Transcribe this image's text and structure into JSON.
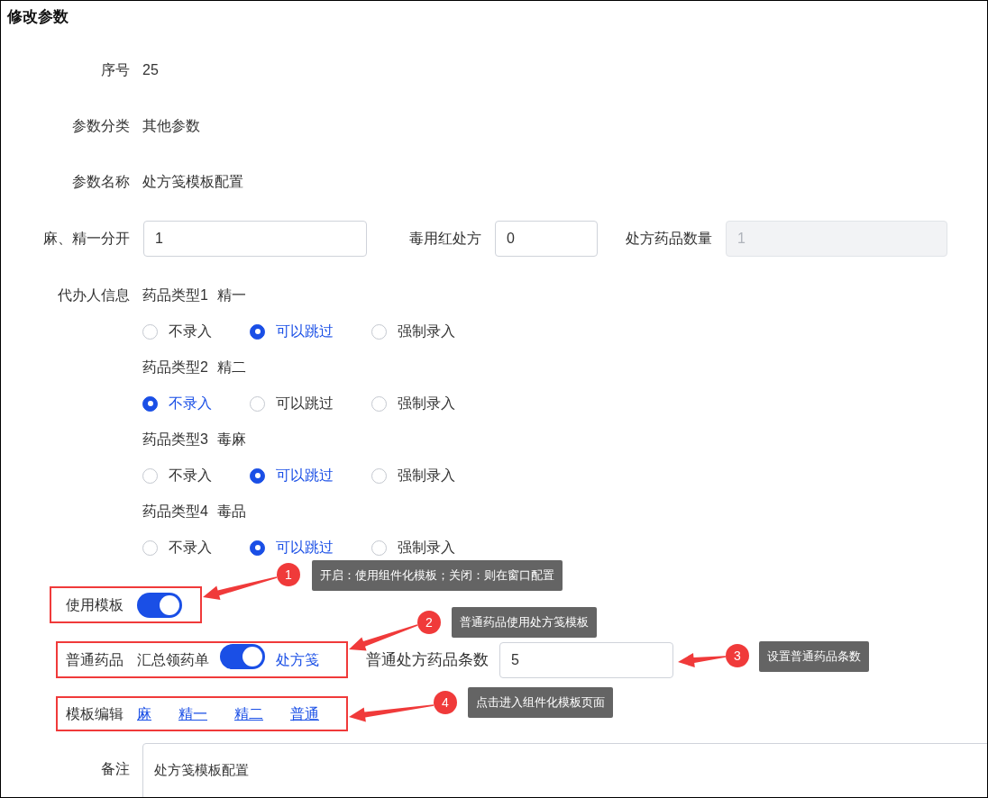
{
  "title": "修改参数",
  "info": [
    {
      "label": "序号",
      "value": "25"
    },
    {
      "label": "参数分类",
      "value": "其他参数"
    },
    {
      "label": "参数名称",
      "value": "处方笺模板配置"
    }
  ],
  "inputs": [
    {
      "label": "麻、精一分开",
      "value": "1",
      "disabled": false
    },
    {
      "label": "毒用红处方",
      "value": "0",
      "disabled": false
    },
    {
      "label": "处方药品数量",
      "value": "1",
      "disabled": true
    }
  ],
  "agent": {
    "label": "代办人信息",
    "groups": [
      {
        "type": "药品类型1",
        "name": "精一",
        "options": [
          {
            "label": "不录入",
            "selected": false
          },
          {
            "label": "可以跳过",
            "selected": true
          },
          {
            "label": "强制录入",
            "selected": false
          }
        ]
      },
      {
        "type": "药品类型2",
        "name": "精二",
        "options": [
          {
            "label": "不录入",
            "selected": true
          },
          {
            "label": "可以跳过",
            "selected": false
          },
          {
            "label": "强制录入",
            "selected": false
          }
        ]
      },
      {
        "type": "药品类型3",
        "name": "毒麻",
        "options": [
          {
            "label": "不录入",
            "selected": false
          },
          {
            "label": "可以跳过",
            "selected": true
          },
          {
            "label": "强制录入",
            "selected": false
          }
        ]
      },
      {
        "type": "药品类型4",
        "name": "毒品",
        "options": [
          {
            "label": "不录入",
            "selected": false
          },
          {
            "label": "可以跳过",
            "selected": true
          },
          {
            "label": "强制录入",
            "selected": false
          }
        ]
      }
    ]
  },
  "template": {
    "label": "使用模板",
    "on": true
  },
  "normal": {
    "label": "普通药品",
    "off_label": "汇总领药单",
    "on": true,
    "on_label": "处方笺",
    "count_label": "普通处方药品条数",
    "count": "5"
  },
  "edit": {
    "label": "模板编辑",
    "links": [
      "麻",
      "精一",
      "精二",
      "普通"
    ]
  },
  "remark": {
    "label": "备注",
    "value": "处方笺模板配置"
  },
  "annotations": [
    {
      "number": "1",
      "text": "开启：使用组件化模板；关闭：则在窗口配置"
    },
    {
      "number": "2",
      "text": "普通药品使用处方笺模板"
    },
    {
      "number": "3",
      "text": "设置普通药品条数"
    },
    {
      "number": "4",
      "text": "点击进入组件化模板页面"
    }
  ]
}
